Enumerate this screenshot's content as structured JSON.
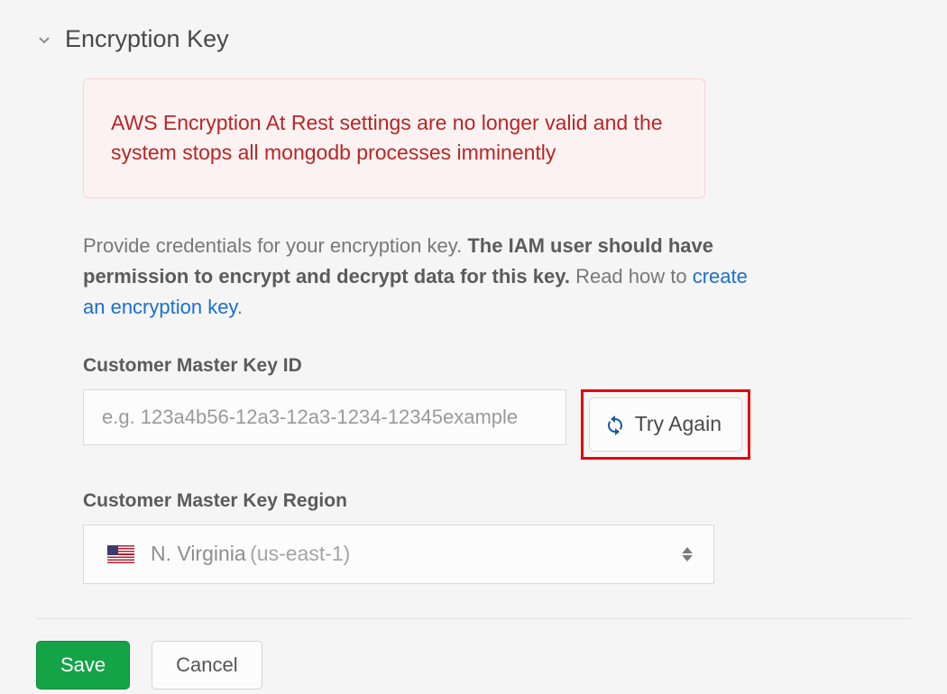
{
  "section": {
    "title": "Encryption Key"
  },
  "alert": {
    "message": "AWS Encryption At Rest settings are no longer valid and the system stops all mongodb processes imminently"
  },
  "description": {
    "intro": "Provide credentials for your encryption key. ",
    "bold": "The IAM user should have permission to encrypt and decrypt data for this key.",
    "read_how": " Read how to ",
    "link_text": "create an encryption key",
    "period": "."
  },
  "key_id": {
    "label": "Customer Master Key ID",
    "placeholder": "e.g. 123a4b56-12a3-12a3-1234-12345example",
    "value": ""
  },
  "try_again": {
    "label": "Try Again"
  },
  "region": {
    "label": "Customer Master Key Region",
    "selected_name": "N. Virginia",
    "selected_code": "(us-east-1)"
  },
  "footer": {
    "save": "Save",
    "cancel": "Cancel"
  }
}
